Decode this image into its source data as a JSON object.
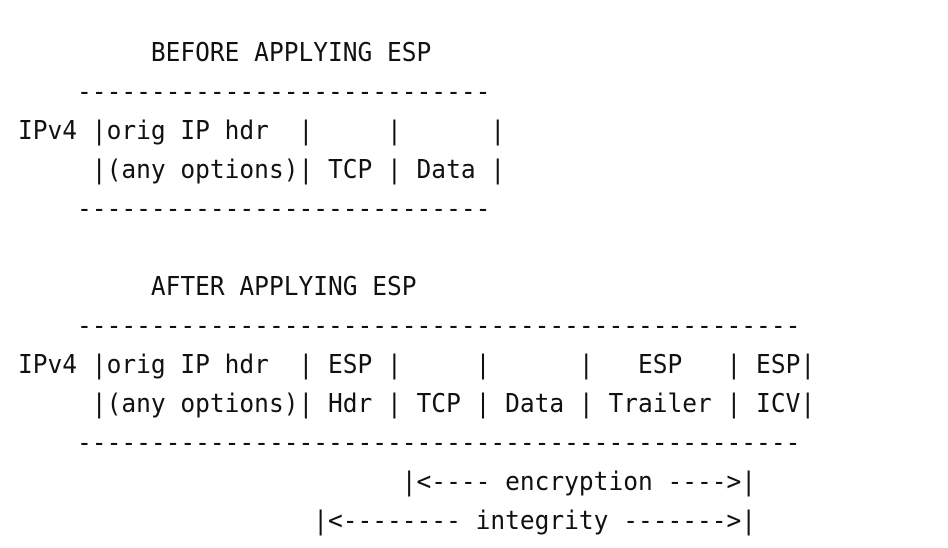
{
  "lines": [
    "         BEFORE APPLYING ESP",
    "    ----------------------------",
    "IPv4 |orig IP hdr  |     |      |",
    "     |(any options)| TCP | Data |",
    "    ----------------------------",
    "",
    "         AFTER APPLYING ESP",
    "    -------------------------------------------------",
    "IPv4 |orig IP hdr  | ESP |     |      |   ESP   | ESP|",
    "     |(any options)| Hdr | TCP | Data | Trailer | ICV|",
    "    -------------------------------------------------",
    "                          |<---- encryption ---->|",
    "                    |<-------- integrity ------->|"
  ]
}
